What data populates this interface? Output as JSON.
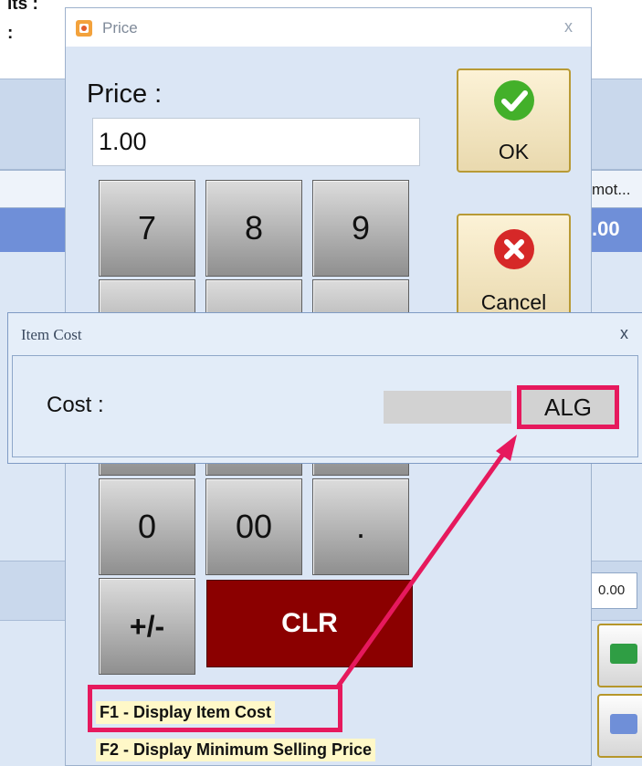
{
  "background": {
    "top_labels": [
      "its :",
      ":"
    ],
    "grid_column_header": "mot...",
    "grid_row_value": ".00",
    "total_field": "0.00"
  },
  "price_dialog": {
    "title": "Price",
    "field_label": "Price :",
    "value": "1.00",
    "ok_label": "OK",
    "cancel_label": "Cancel",
    "keys": [
      "7",
      "8",
      "9",
      "0",
      "00",
      ".",
      "+/-"
    ],
    "clear_label": "CLR",
    "hints": [
      "F1 - Display Item Cost",
      "F2 - Display Minimum Selling Price"
    ],
    "close_glyph": "x"
  },
  "cost_dialog": {
    "title": "Item Cost",
    "label": "Cost :",
    "value": "ALG",
    "close_glyph": "x"
  },
  "colors": {
    "highlight": "#e6195d",
    "clear_button": "#8b0000",
    "ok_icon": "#43b02a",
    "cancel_icon": "#d62828"
  },
  "icons": [
    "price-app-icon",
    "ok-check-icon",
    "cancel-x-icon",
    "cash-icon",
    "card-icon",
    "close-icon"
  ]
}
